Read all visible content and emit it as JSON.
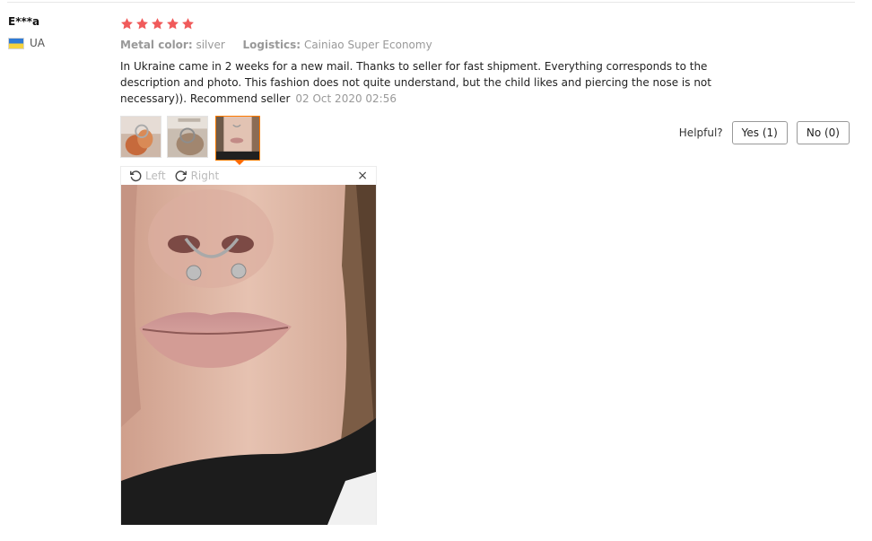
{
  "reviewer": {
    "name": "E***a",
    "country": "UA",
    "flag_colors": [
      "#2f7bd6",
      "#f6d33d"
    ]
  },
  "rating": {
    "stars": 5,
    "max": 5,
    "color": "#f05a5a"
  },
  "meta": {
    "metal_color_label": "Metal color:",
    "metal_color_value": "silver",
    "logistics_label": "Logistics:",
    "logistics_value": "Cainiao Super Economy"
  },
  "review": {
    "text": "In Ukraine came in 2 weeks for a new mail. Thanks to seller for fast shipment. Everything corresponds to the description and photo. This fashion does not quite understand, but the child likes and piercing the nose is not necessary)). Recommend seller",
    "date": "02 Oct 2020 02:56"
  },
  "thumbnails": [
    {
      "selected": false
    },
    {
      "selected": false
    },
    {
      "selected": true
    }
  ],
  "viewer": {
    "rotate_left": "Left",
    "rotate_right": "Right",
    "close": "×"
  },
  "helpful": {
    "label": "Helpful?",
    "yes": "Yes (1)",
    "no": "No (0)"
  },
  "accent_color": "#ff6a00"
}
